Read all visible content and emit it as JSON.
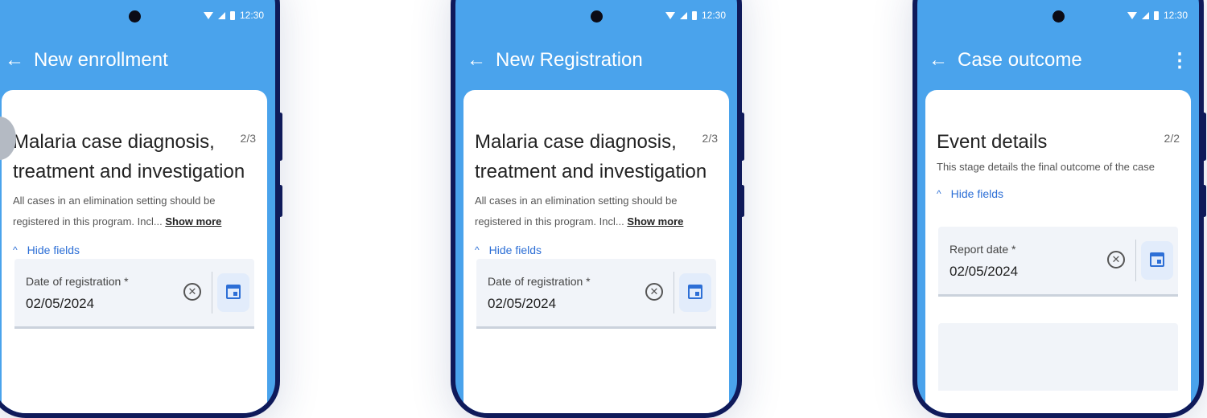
{
  "status_bar": {
    "time": "12:30"
  },
  "screens": [
    {
      "app_bar_title": "New enrollment",
      "section_title": "Malaria case diagnosis, treatment and investigation",
      "step": "2/3",
      "description": "All cases in an elimination setting should be registered in this program. Incl...",
      "show_more_label": "Show more",
      "hide_fields_label": "Hide fields",
      "field_label": "Date of registration *",
      "field_value": "02/05/2024"
    },
    {
      "app_bar_title": "New Registration",
      "section_title": "Malaria case diagnosis, treatment and investigation",
      "step": "2/3",
      "description": "All cases in an elimination setting should be registered in this program. Incl...",
      "show_more_label": "Show more",
      "hide_fields_label": "Hide fields",
      "field_label": "Date of registration *",
      "field_value": "02/05/2024"
    },
    {
      "app_bar_title": "Case outcome",
      "section_title": "Event details",
      "step": "2/2",
      "description": "This stage details the final outcome of the case",
      "hide_fields_label": "Hide fields",
      "field_label": "Report date *",
      "field_value": "02/05/2024"
    }
  ]
}
